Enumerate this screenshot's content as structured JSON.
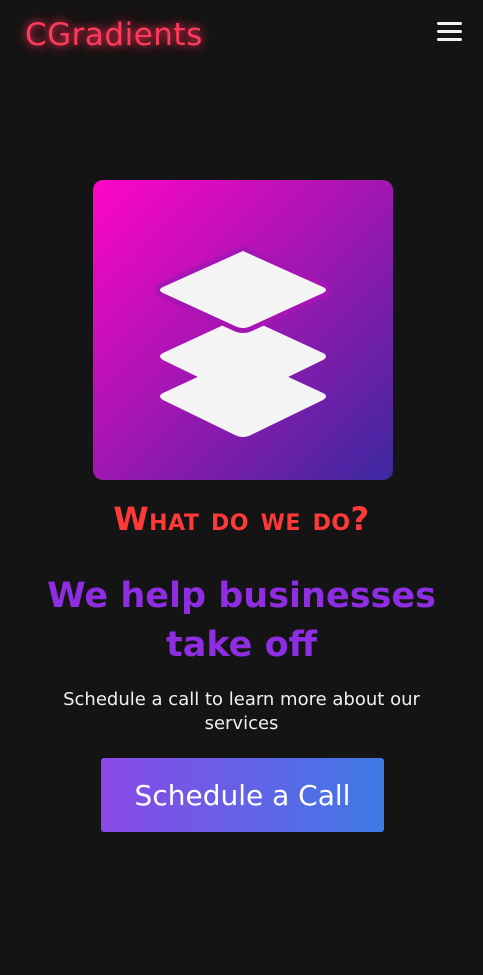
{
  "header": {
    "brand": "CGradients",
    "menu_icon": "hamburger-menu-icon"
  },
  "hero": {
    "icon": "layers-icon"
  },
  "section": {
    "eyebrow": "What do we do?",
    "headline": "We help businesses take off",
    "subtext": "Schedule a call to learn more about our services",
    "cta_label": "Schedule a Call"
  },
  "colors": {
    "background": "#141414",
    "brand": "#ff3b5c",
    "eyebrow": "#ff3838",
    "headline": "#8e2de2",
    "tile_gradient": [
      "#ff05c8",
      "#a915b3",
      "#3b28a0"
    ],
    "cta_gradient": [
      "#8a49e6",
      "#3f7ae6"
    ]
  }
}
